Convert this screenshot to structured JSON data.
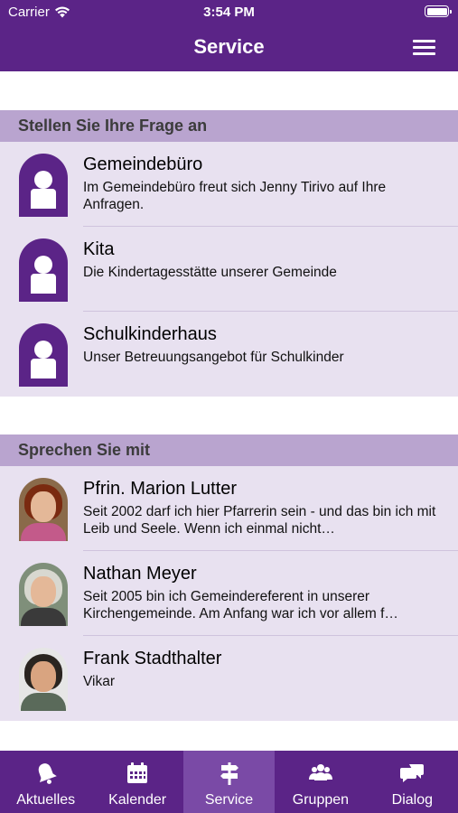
{
  "status_bar": {
    "carrier": "Carrier",
    "time": "3:54 PM"
  },
  "nav": {
    "title": "Service",
    "menu_icon": "hamburger-menu-icon"
  },
  "sections": [
    {
      "header": "Stellen Sie Ihre Frage an",
      "items": [
        {
          "title": "Gemeindebüro",
          "description": "Im Gemeindebüro freut sich Jenny Tirivo auf Ihre Anfragen.",
          "avatar": "generic-person-icon"
        },
        {
          "title": "Kita",
          "description": "Die Kindertagesstätte unserer Gemeinde",
          "avatar": "generic-person-icon"
        },
        {
          "title": "Schulkinderhaus",
          "description": "Unser Betreuungsangebot für Schulkinder",
          "avatar": "generic-person-icon"
        }
      ]
    },
    {
      "header": "Sprechen Sie mit",
      "items": [
        {
          "title": "Pfrin. Marion Lutter",
          "description": "Seit 2002 darf ich hier Pfarrerin sein - und das bin ich mit Leib und Seele. Wenn ich einmal nicht…",
          "avatar": "portrait-photo"
        },
        {
          "title": "Nathan Meyer",
          "description": "Seit 2005 bin ich Gemeindereferent in unserer Kirchengemeinde. Am Anfang war ich vor allem f…",
          "avatar": "portrait-photo"
        },
        {
          "title": "Frank Stadthalter",
          "description": "Vikar",
          "avatar": "portrait-photo"
        }
      ]
    }
  ],
  "tabs": [
    {
      "label": "Aktuelles",
      "icon": "bell-icon",
      "active": false
    },
    {
      "label": "Kalender",
      "icon": "calendar-icon",
      "active": false
    },
    {
      "label": "Service",
      "icon": "signpost-icon",
      "active": true
    },
    {
      "label": "Gruppen",
      "icon": "group-icon",
      "active": false
    },
    {
      "label": "Dialog",
      "icon": "chat-bubbles-icon",
      "active": false
    }
  ],
  "colors": {
    "primary": "#5b2487",
    "active_tab": "#7a4aa6",
    "section_header": "#b9a4cf",
    "row_background": "#e8e1f0"
  }
}
